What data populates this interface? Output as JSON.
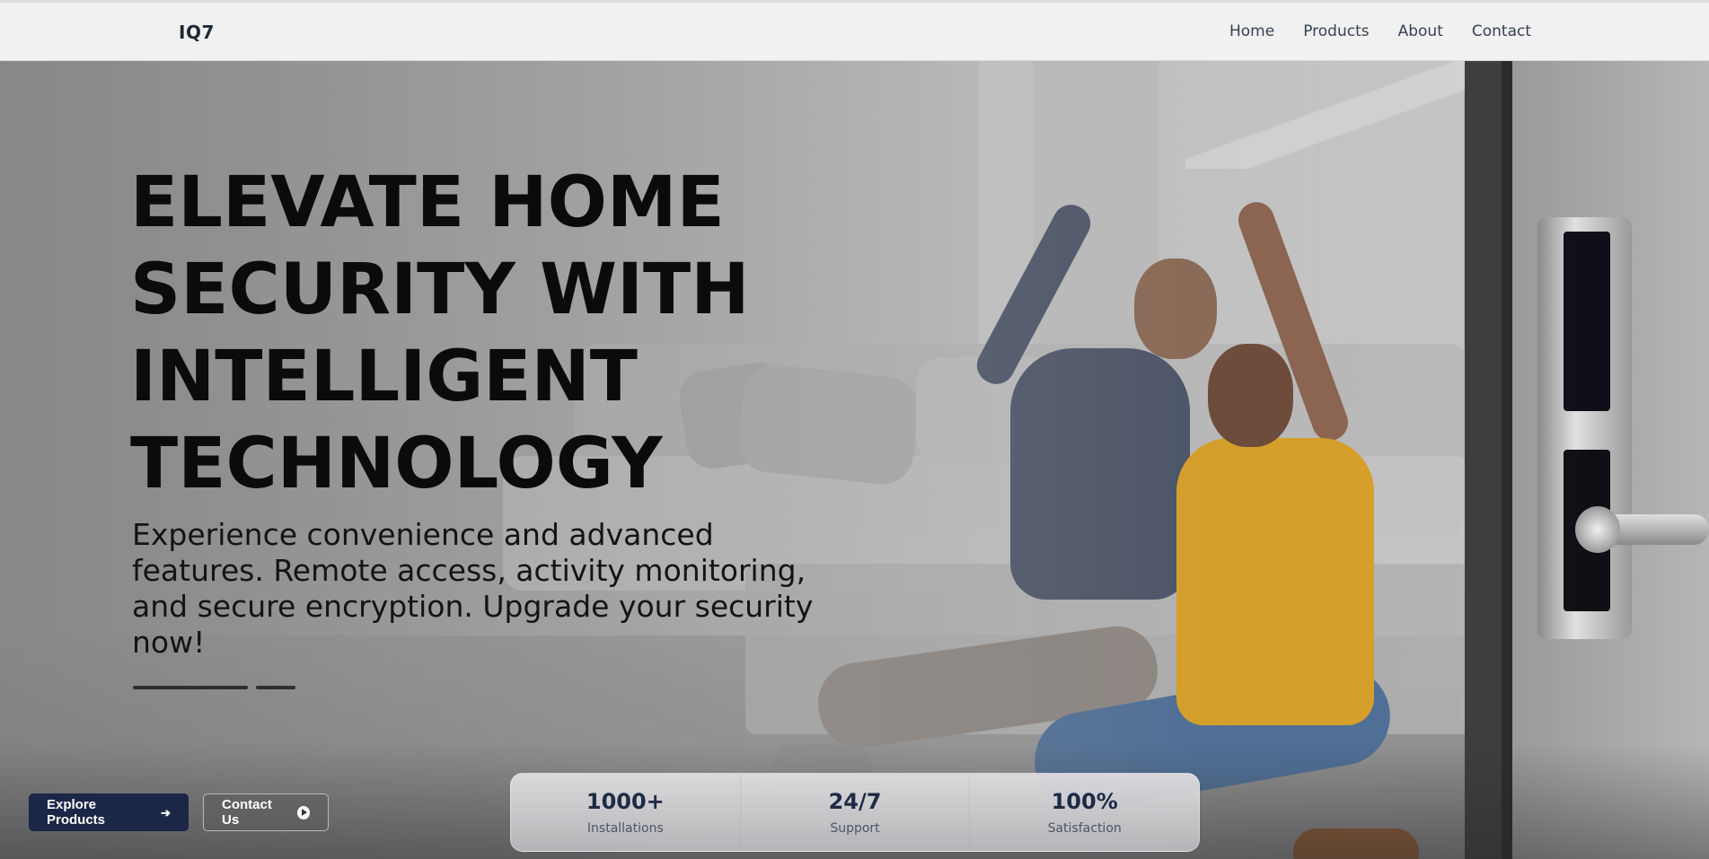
{
  "brand": {
    "logo": "IQ7"
  },
  "nav": {
    "items": [
      {
        "label": "Home"
      },
      {
        "label": "Products"
      },
      {
        "label": "About"
      },
      {
        "label": "Contact"
      }
    ]
  },
  "hero": {
    "title_lines": [
      "ELEVATE HOME",
      "SECURITY WITH",
      "INTELLIGENT",
      "TECHNOLOGY"
    ],
    "subtitle": "Experience convenience and advanced features. Remote access, activity monitoring, and secure encryption. Upgrade your security now!",
    "slide_indicator": {
      "active": 1,
      "total": 2
    }
  },
  "actions": {
    "primary": {
      "label": "Explore Products",
      "icon": "arrow-right-icon"
    },
    "secondary": {
      "label": "Contact Us",
      "icon": "play-circle-icon"
    }
  },
  "stats": [
    {
      "value": "1000+",
      "label": "Installations"
    },
    {
      "value": "24/7",
      "label": "Support"
    },
    {
      "value": "100%",
      "label": "Satisfaction"
    }
  ],
  "colors": {
    "primary_button": "#1c2647",
    "title_text": "#0b0b0b",
    "stat_value": "#1f2a44"
  }
}
